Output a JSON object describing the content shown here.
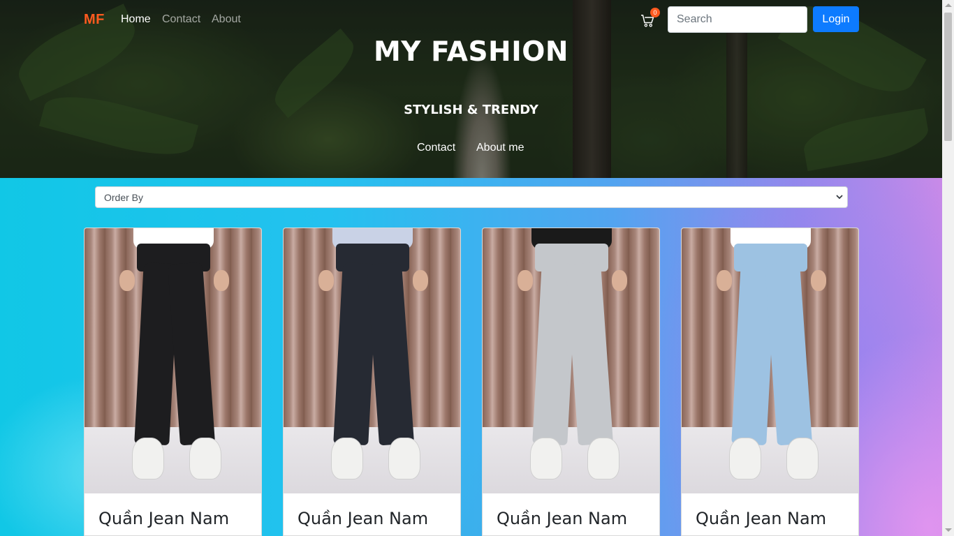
{
  "nav": {
    "brand": "MF",
    "links": [
      "Home",
      "Contact",
      "About"
    ],
    "cart_count": "0",
    "search_placeholder": "Search",
    "login_label": "Login"
  },
  "hero": {
    "title": "MY FASHION",
    "subtitle": "STYLISH & TRENDY",
    "links": [
      "Contact",
      "About me"
    ]
  },
  "filter": {
    "order_by": "Order By"
  },
  "products": [
    {
      "title": "Quần Jean Nam",
      "jean_color": "#1d1d1f",
      "shirt_color": "#ffffff"
    },
    {
      "title": "Quần Jean Nam",
      "jean_color": "#262a33",
      "shirt_color": "#c9d2e6"
    },
    {
      "title": "Quần Jean Nam",
      "jean_color": "#c4c7cb",
      "shirt_color": "#1a1a1a"
    },
    {
      "title": "Quần Jean Nam",
      "jean_color": "#9dc2e2",
      "shirt_color": "#ffffff"
    }
  ],
  "colors": {
    "brand": "#ff5a1f",
    "login_bg": "#0d7bff"
  }
}
